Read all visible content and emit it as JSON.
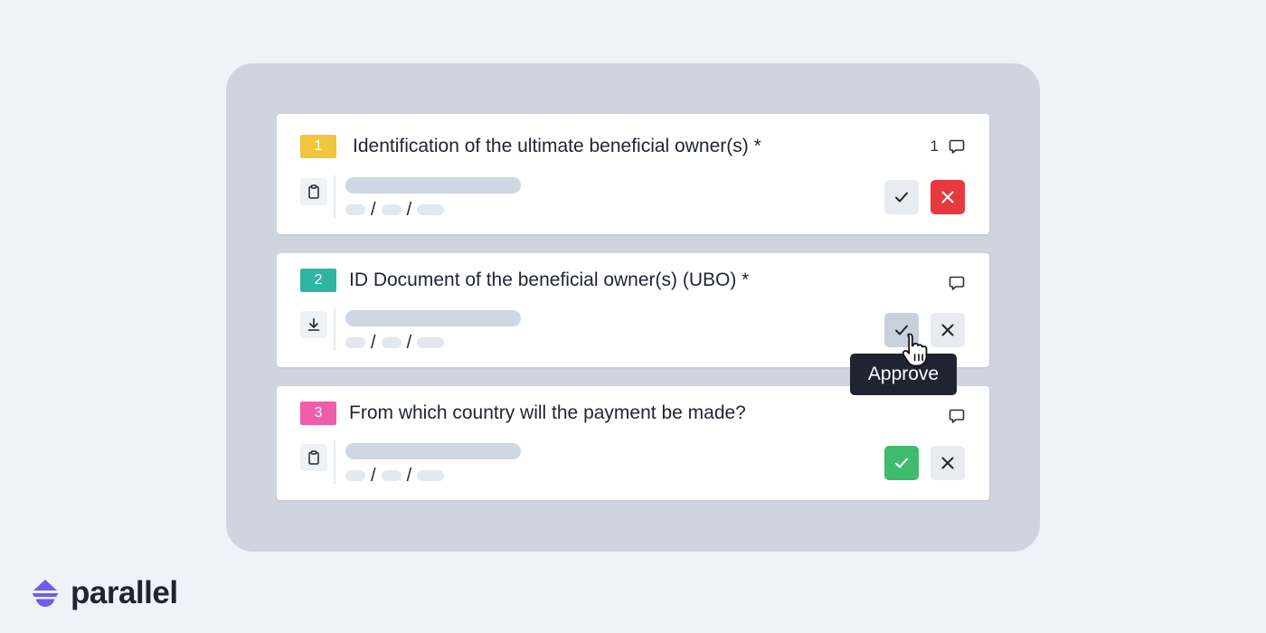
{
  "questions": [
    {
      "number": "1",
      "number_color": "#efc63e",
      "title": "Identification of the ultimate beneficial owner(s) *",
      "comment_count": "1",
      "field_icon": "clipboard-icon",
      "approve_state": "neutral",
      "reject_state": "rejected"
    },
    {
      "number": "2",
      "number_color": "#2fb3a3",
      "title": "ID Document of the beneficial owner(s) (UBO) *",
      "comment_count": "",
      "field_icon": "download-icon",
      "approve_state": "hovered",
      "reject_state": "neutral"
    },
    {
      "number": "3",
      "number_color": "#ef5da8",
      "title": "From which country will the payment be made?",
      "comment_count": "",
      "field_icon": "clipboard-icon",
      "approve_state": "approved",
      "reject_state": "neutral"
    }
  ],
  "separator": "/",
  "tooltip": {
    "label": "Approve"
  },
  "brand": {
    "name": "parallel",
    "color": "#6e5cf0"
  },
  "colors": {
    "background": "#eef2f9",
    "panel": "#cfd5df",
    "reject_red": "#e5393f",
    "approve_green": "#3dbb6e"
  }
}
